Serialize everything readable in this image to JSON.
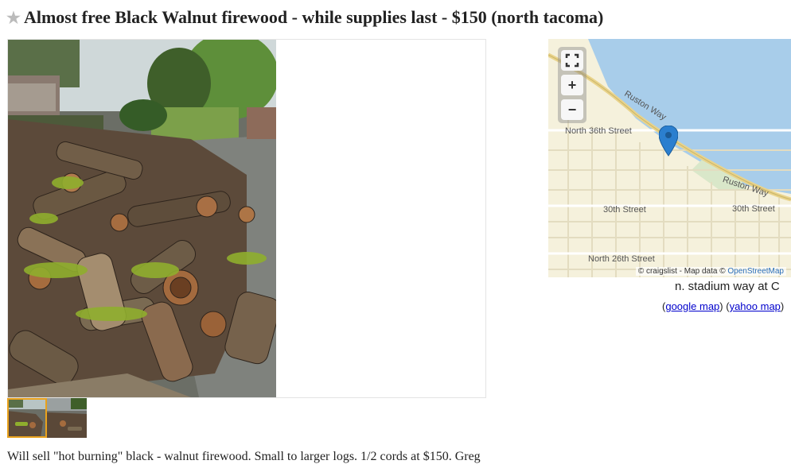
{
  "posting": {
    "title": "Almost free Black Walnut firewood - while supplies last - $150 (north tacoma)",
    "favorite_icon": "star-icon",
    "body": "Will sell \"hot burning\" black - walnut firewood. Small to larger logs. 1/2 cords at $150. Greg"
  },
  "gallery": {
    "thumbnail_count": 2,
    "selected_thumbnail": 1,
    "selected_color": "#e9a21d"
  },
  "map": {
    "street_labels": [
      "Ruston Way",
      "North 36th Street",
      "Ruston Way",
      "30th Street",
      "30th Street",
      "North 26th Street"
    ],
    "attribution_prefix": "© craigslist - Map data © ",
    "attribution_link": "OpenStreetMap",
    "controls": {
      "fullscreen_icon": "fullscreen-icon",
      "zoom_in": "+",
      "zoom_out": "−"
    },
    "water_color": "#a8cdea",
    "land_color": "#f5f1dc",
    "marker_color": "#2b7fcf"
  },
  "mapaddress": "n. stadium way at C",
  "maplinks": {
    "open": "(",
    "google": "google map",
    "mid": ") (",
    "yahoo": "yahoo map",
    "close": ")"
  }
}
